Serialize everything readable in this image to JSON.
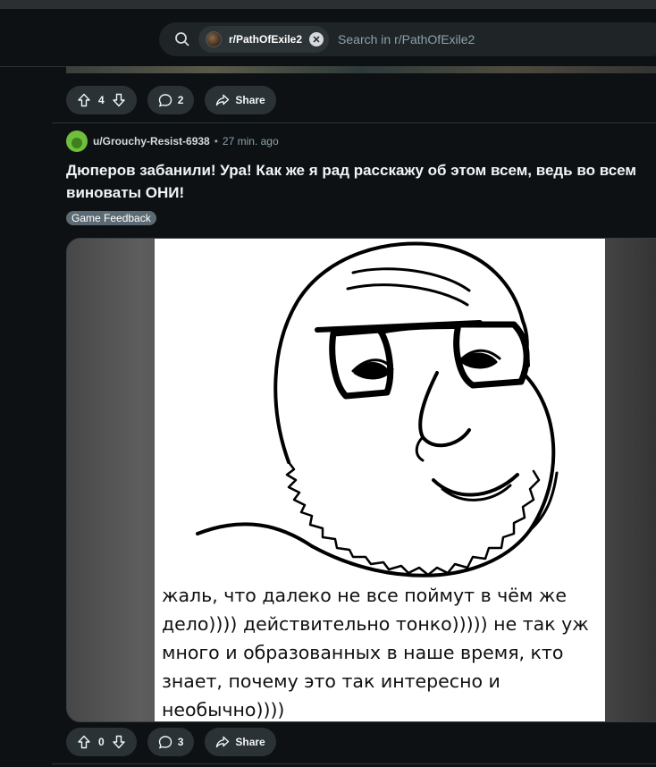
{
  "search": {
    "subreddit_chip": "r/PathOfExile2",
    "placeholder": "Search in r/PathOfExile2"
  },
  "previous_post": {
    "votes": "4",
    "comments": "2",
    "share_label": "Share"
  },
  "post": {
    "author": "u/Grouchy-Resist-6938",
    "separator": "•",
    "time": "27 min. ago",
    "title": "Дюперов забанили! Ура! Как же я рад расскажу об этом всем, ведь во всем виноваты ОНИ!",
    "flair": "Game Feedback",
    "image_caption_lines": [
      "жаль, что далеко не все поймут в чём же",
      "дело)))) действительно тонко))))) не так уж",
      "много и образованных в наше время, кто",
      "знает, почему это так интересно и",
      "необычно))))"
    ],
    "votes": "0",
    "comments": "3",
    "share_label": "Share"
  },
  "colors": {
    "background": "#0e1113",
    "pill": "#2a3236",
    "flair": "#5c6b73",
    "avatar": "#6fbf3a"
  }
}
